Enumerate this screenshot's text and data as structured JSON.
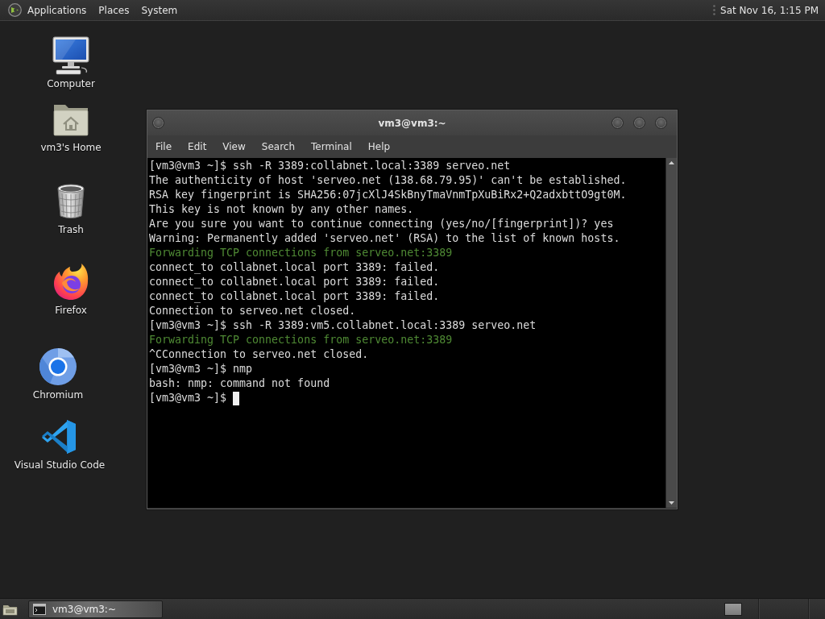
{
  "top_panel": {
    "menus": [
      "Applications",
      "Places",
      "System"
    ],
    "clock": "Sat Nov 16, 1:15 PM"
  },
  "desktop_icons": [
    {
      "label": "Computer",
      "kind": "computer"
    },
    {
      "label": "vm3's Home",
      "kind": "home"
    },
    {
      "label": "Trash",
      "kind": "trash"
    },
    {
      "label": "Firefox",
      "kind": "firefox"
    },
    {
      "label": "Chromium",
      "kind": "chromium"
    },
    {
      "label": "Visual Studio Code",
      "kind": "vscode"
    }
  ],
  "terminal_window": {
    "title": "vm3@vm3:~",
    "menu": [
      "File",
      "Edit",
      "View",
      "Search",
      "Terminal",
      "Help"
    ],
    "lines": [
      {
        "text": "[vm3@vm3 ~]$ ssh -R 3389:collabnet.local:3389 serveo.net",
        "kind": "output"
      },
      {
        "text": "The authenticity of host 'serveo.net (138.68.79.95)' can't be established.",
        "kind": "output"
      },
      {
        "text": "RSA key fingerprint is SHA256:07jcXlJ4SkBnyTmaVnmTpXuBiRx2+Q2adxbttO9gt0M.",
        "kind": "output"
      },
      {
        "text": "This key is not known by any other names.",
        "kind": "output"
      },
      {
        "text": "Are you sure you want to continue connecting (yes/no/[fingerprint])? yes",
        "kind": "output"
      },
      {
        "text": "Warning: Permanently added 'serveo.net' (RSA) to the list of known hosts.",
        "kind": "output"
      },
      {
        "text": "Forwarding TCP connections from serveo.net:3389",
        "kind": "info"
      },
      {
        "text": "connect_to collabnet.local port 3389: failed.",
        "kind": "output"
      },
      {
        "text": "connect_to collabnet.local port 3389: failed.",
        "kind": "output"
      },
      {
        "text": "connect_to collabnet.local port 3389: failed.",
        "kind": "output"
      },
      {
        "text": "Connection to serveo.net closed.",
        "kind": "output"
      },
      {
        "text": "[vm3@vm3 ~]$ ssh -R 3389:vm5.collabnet.local:3389 serveo.net",
        "kind": "output"
      },
      {
        "text": "Forwarding TCP connections from serveo.net:3389",
        "kind": "info"
      },
      {
        "text": "^CConnection to serveo.net closed.",
        "kind": "output"
      },
      {
        "text": "[vm3@vm3 ~]$ nmp",
        "kind": "output"
      },
      {
        "text": "bash: nmp: command not found",
        "kind": "output"
      },
      {
        "text": "[vm3@vm3 ~]$",
        "kind": "output"
      }
    ],
    "cursor_visible": true
  },
  "taskbar": {
    "tasks": [
      {
        "label": "vm3@vm3:~",
        "selected": true
      }
    ]
  }
}
